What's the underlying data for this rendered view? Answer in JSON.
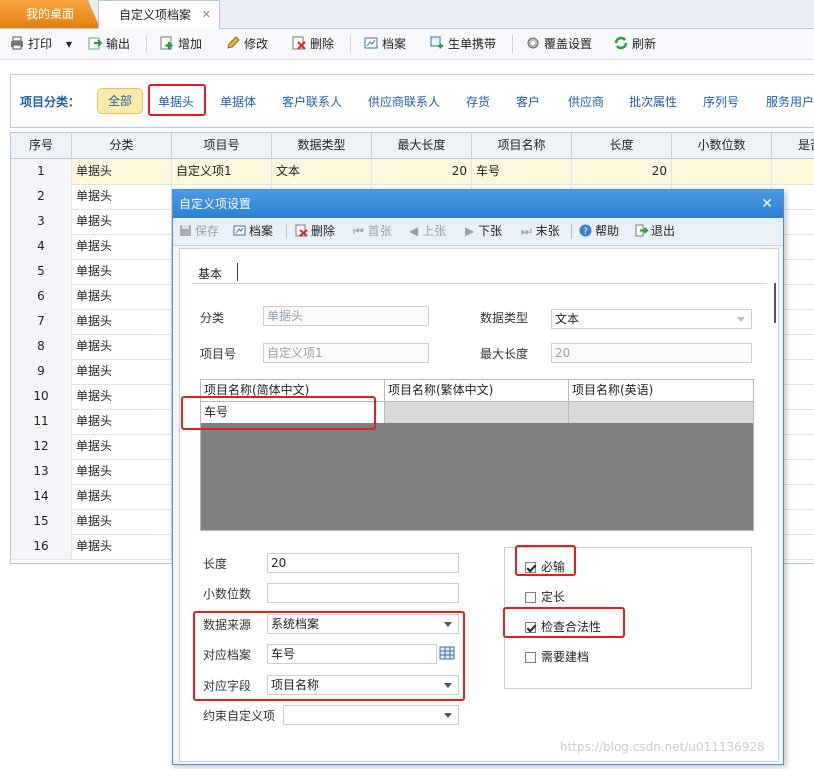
{
  "tabs": {
    "desk": "我的桌面",
    "active": "自定义项档案",
    "close": "✕"
  },
  "toolbar": {
    "print": "打印",
    "print_dd": "▾",
    "export": "输出",
    "add": "增加",
    "edit": "修改",
    "delete": "删除",
    "archive": "档案",
    "gen": "生单携带",
    "cover": "覆盖设置",
    "refresh": "刷新"
  },
  "category": {
    "label": "项目分类：",
    "all": "全部",
    "items": [
      "单据头",
      "单据体",
      "客户联系人",
      "供应商联系人",
      "存货",
      "客户",
      "供应商",
      "批次属性",
      "序列号",
      "服务用户"
    ]
  },
  "grid": {
    "headers": [
      "序号",
      "分类",
      "项目号",
      "数据类型",
      "最大长度",
      "项目名称",
      "长度",
      "小数位数",
      "是否"
    ],
    "first_row": {
      "no": "1",
      "cat": "单据头",
      "code": "自定义项1",
      "type": "文本",
      "maxlen": "20",
      "name": "车号",
      "len": "20",
      "dec": ""
    },
    "rows": [
      {
        "no": "2",
        "cat": "单据头"
      },
      {
        "no": "3",
        "cat": "单据头"
      },
      {
        "no": "4",
        "cat": "单据头"
      },
      {
        "no": "5",
        "cat": "单据头"
      },
      {
        "no": "6",
        "cat": "单据头"
      },
      {
        "no": "7",
        "cat": "单据头"
      },
      {
        "no": "8",
        "cat": "单据头"
      },
      {
        "no": "9",
        "cat": "单据头"
      },
      {
        "no": "10",
        "cat": "单据头"
      },
      {
        "no": "11",
        "cat": "单据头"
      },
      {
        "no": "12",
        "cat": "单据头"
      },
      {
        "no": "13",
        "cat": "单据头"
      },
      {
        "no": "14",
        "cat": "单据头"
      },
      {
        "no": "15",
        "cat": "单据头"
      },
      {
        "no": "16",
        "cat": "单据头"
      }
    ]
  },
  "dialog": {
    "title": "自定义项设置",
    "close": "✕",
    "toolbar": {
      "save": "保存",
      "archive": "档案",
      "delete": "删除",
      "first": "首张",
      "prev": "上张",
      "next": "下张",
      "last": "末张",
      "help": "帮助",
      "exit": "退出"
    },
    "tab": "基本",
    "fields": {
      "category_label": "分类",
      "category_value": "单据头",
      "type_label": "数据类型",
      "type_value": "文本",
      "code_label": "项目号",
      "code_value": "自定义项1",
      "maxlen_label": "最大长度",
      "maxlen_value": "20",
      "length_label": "长度",
      "length_value": "20",
      "decimal_label": "小数位数",
      "decimal_value": "",
      "source_label": "数据来源",
      "source_value": "系统档案",
      "archive_label": "对应档案",
      "archive_value": "车号",
      "field_label": "对应字段",
      "field_value": "项目名称",
      "constraint_label": "约束自定义项",
      "constraint_value": ""
    },
    "name_grid": {
      "headers": [
        "项目名称(简体中文)",
        "项目名称(繁体中文)",
        "项目名称(英语)"
      ],
      "row": [
        "车号",
        "",
        ""
      ]
    },
    "checks": [
      {
        "label": "必输",
        "checked": true
      },
      {
        "label": "定长",
        "checked": false
      },
      {
        "label": "检查合法性",
        "checked": true
      },
      {
        "label": "需要建档",
        "checked": false
      }
    ]
  },
  "watermark": "https://blog.csdn.net/u011136928"
}
